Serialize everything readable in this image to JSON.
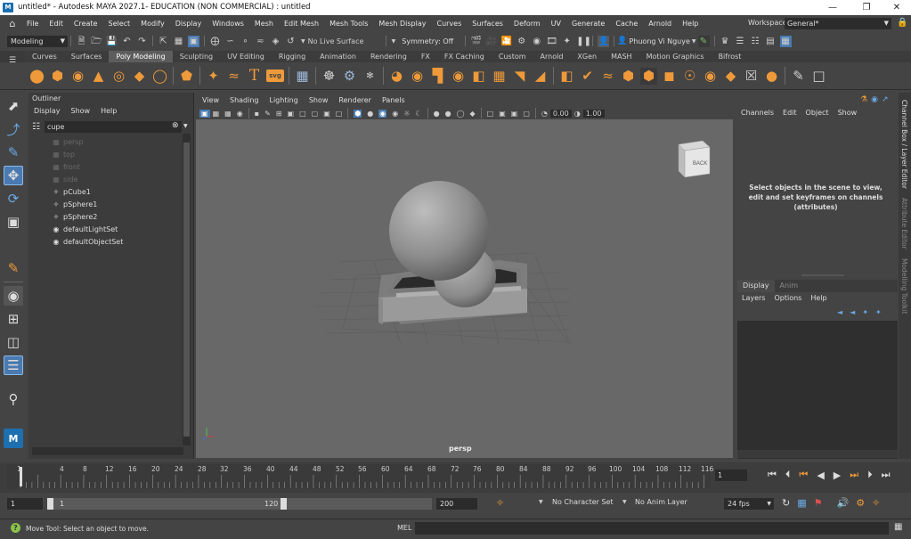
{
  "window": {
    "title": "untitled* - Autodesk MAYA 2027.1- EDUCATION (NON COMMERCIAL) : untitled",
    "app_icon_letter": "M"
  },
  "menubar": {
    "items": [
      "File",
      "Edit",
      "Create",
      "Select",
      "Modify",
      "Display",
      "Windows",
      "Mesh",
      "Edit Mesh",
      "Mesh Tools",
      "Mesh Display",
      "Curves",
      "Surfaces",
      "Deform",
      "UV",
      "Generate",
      "Cache",
      "Arnold",
      "Help"
    ],
    "workspace_label": "Workspace:",
    "workspace_value": "General*"
  },
  "statusline": {
    "menuset": "Modeling",
    "live_surface": "No Live Surface",
    "symmetry": "Symmetry: Off",
    "user": "Phuong Vi Nguye"
  },
  "shelf": {
    "tabs": [
      "Curves",
      "Surfaces",
      "Poly Modeling",
      "Sculpting",
      "UV Editing",
      "Rigging",
      "Animation",
      "Rendering",
      "FX",
      "FX Caching",
      "Custom",
      "Arnold",
      "XGen",
      "MASH",
      "Motion Graphics",
      "Bifrost"
    ],
    "active_tab": "Poly Modeling",
    "svg_label": "svg"
  },
  "outliner": {
    "title": "Outliner",
    "menu": [
      "Display",
      "Show",
      "Help"
    ],
    "search_value": "cupe",
    "items": [
      {
        "label": "persp",
        "kind": "camera",
        "dim": true
      },
      {
        "label": "top",
        "kind": "camera",
        "dim": true
      },
      {
        "label": "front",
        "kind": "camera",
        "dim": true
      },
      {
        "label": "side",
        "kind": "camera",
        "dim": true
      },
      {
        "label": "pCube1",
        "kind": "mesh",
        "dim": false
      },
      {
        "label": "pSphere1",
        "kind": "mesh",
        "dim": false
      },
      {
        "label": "pSphere2",
        "kind": "mesh",
        "dim": false
      },
      {
        "label": "defaultLightSet",
        "kind": "set",
        "dim": false
      },
      {
        "label": "defaultObjectSet",
        "kind": "set",
        "dim": false
      }
    ]
  },
  "viewport": {
    "menu": [
      "View",
      "Shading",
      "Lighting",
      "Show",
      "Renderer",
      "Panels"
    ],
    "field1": "0.00",
    "field2": "1.00",
    "camera_label": "persp",
    "viewcube_label": "BACK"
  },
  "channelbox": {
    "menu": [
      "Channels",
      "Edit",
      "Object",
      "Show"
    ],
    "message": "Select objects in the scene to view, edit and set keyframes on channels (attributes)",
    "layer_tabs": [
      "Display",
      "Anim"
    ],
    "layer_menu": [
      "Layers",
      "Options",
      "Help"
    ],
    "side_tabs": [
      "Channel Box / Layer Editor",
      "Attribute Editor",
      "Modelling Toolkit"
    ]
  },
  "timeline": {
    "ticks": [
      "1",
      "4",
      "8",
      "12",
      "16",
      "20",
      "24",
      "28",
      "32",
      "36",
      "40",
      "44",
      "48",
      "52",
      "56",
      "60",
      "64",
      "68",
      "72",
      "76",
      "80",
      "84",
      "88",
      "92",
      "96",
      "100",
      "104",
      "108",
      "112",
      "116",
      "12"
    ],
    "current_frame": "1",
    "playback_buttons": [
      "go-start",
      "step-back-key",
      "step-back",
      "play-back",
      "play-forward",
      "step-forward",
      "step-forward-key",
      "go-end"
    ]
  },
  "range": {
    "start": "1",
    "inner_start": "1",
    "inner_end": "120",
    "end": "200",
    "character_set": "No Character Set",
    "anim_layer": "No Anim Layer",
    "fps": "24 fps"
  },
  "helpline": {
    "message": "Move Tool: Select an object to move.",
    "mel_label": "MEL"
  }
}
